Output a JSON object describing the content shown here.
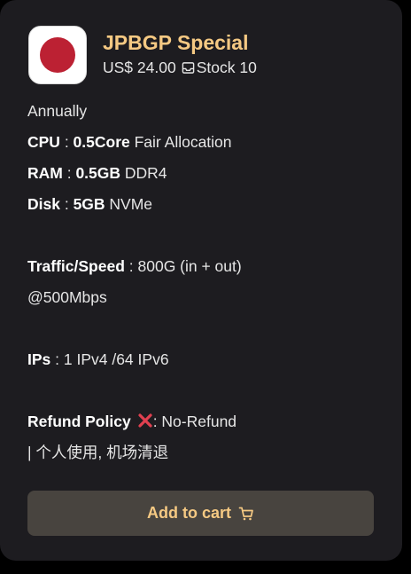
{
  "colors": {
    "accent": "#f5c983",
    "flag_red": "#bc2133",
    "refund_cross": "#e04050"
  },
  "product": {
    "logo_icon": "japan-flag-icon",
    "title": "JPBGP Special",
    "price": "US$ 24.00",
    "stock_icon": "inbox-icon",
    "stock_label": "Stock 10"
  },
  "specs": {
    "billing_cycle": "Annually",
    "cpu": {
      "label": "CPU",
      "sep": " : ",
      "value": "0.5Core",
      "note": " Fair Allocation"
    },
    "ram": {
      "label": "RAM",
      "sep": " : ",
      "value": "0.5GB",
      "note": " DDR4"
    },
    "disk": {
      "label": "Disk",
      "sep": " : ",
      "value": "5GB",
      "note": " NVMe"
    },
    "traffic": {
      "label": "Traffic/Speed",
      "value": " : 800G (in + out)",
      "value_cont": "@500Mbps"
    },
    "ips": {
      "label": "IPs",
      "value": " : 1 IPv4 /64 IPv6"
    },
    "refund": {
      "label": "Refund Policy",
      "icon": "cross-mark-icon",
      "value": ": No-Refund",
      "value_cont": "| 个人使用, 机场清退"
    }
  },
  "cart_button": {
    "label": "Add to cart",
    "icon": "shopping-cart-icon"
  }
}
